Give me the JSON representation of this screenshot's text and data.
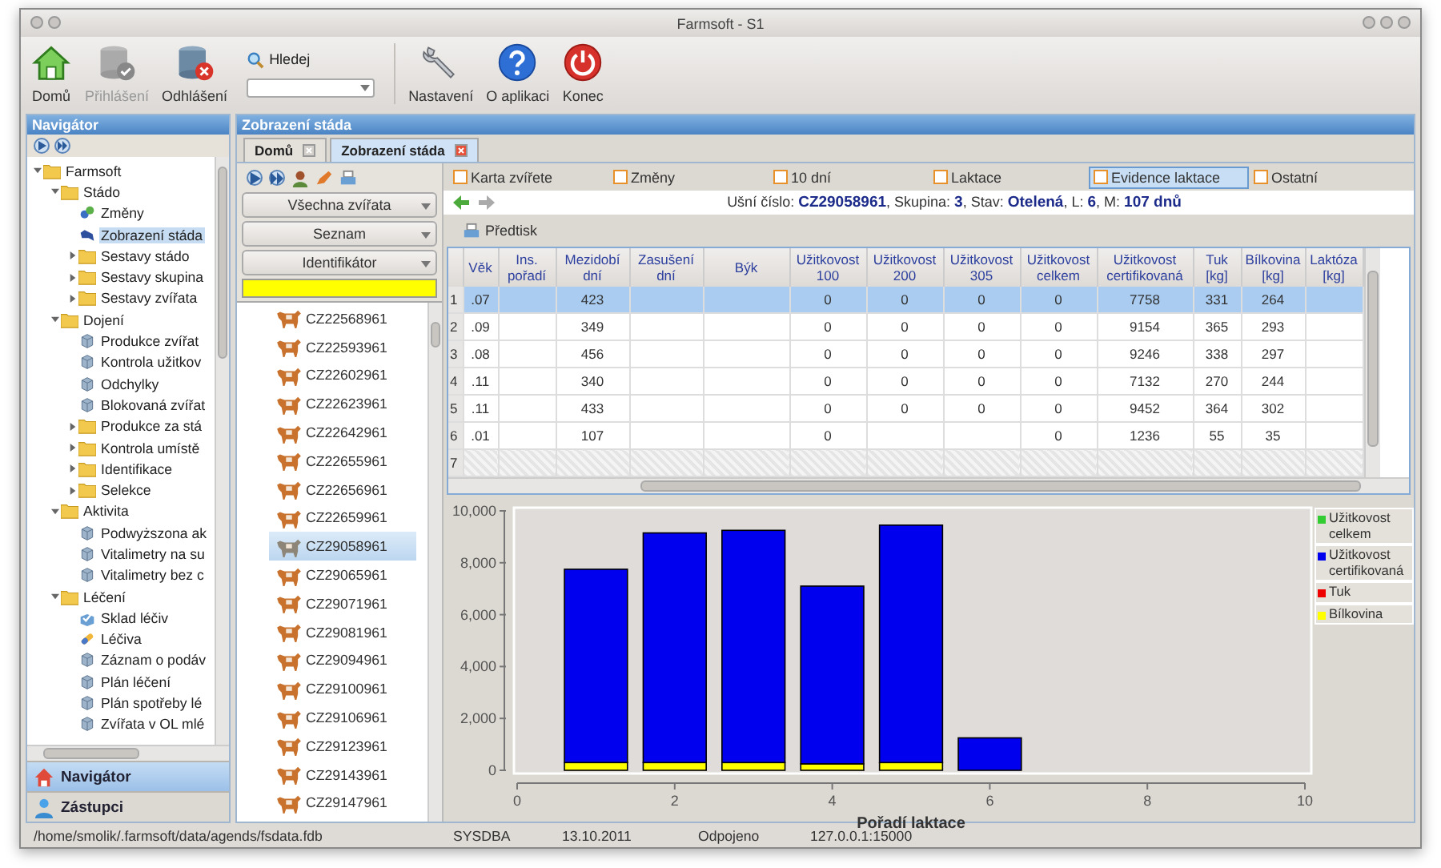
{
  "window": {
    "title": "Farmsoft - S1"
  },
  "toolbar": {
    "buttons": [
      {
        "label": "Domů",
        "kind": "home",
        "disabled": false
      },
      {
        "label": "Přihlášení",
        "kind": "login",
        "disabled": true
      },
      {
        "label": "Odhlášení",
        "kind": "logout",
        "disabled": false
      }
    ],
    "search": {
      "label": "Hledej"
    },
    "buttons_right": [
      {
        "label": "Nastavení",
        "kind": "settings",
        "disabled": false
      },
      {
        "label": "O aplikaci",
        "kind": "help",
        "disabled": false
      },
      {
        "label": "Konec",
        "kind": "power",
        "disabled": false
      }
    ]
  },
  "navigator": {
    "title": "Navigátor",
    "tree": [
      {
        "label": "Farmsoft",
        "kind": "folder",
        "expanded": true,
        "selected": false,
        "children": [
          {
            "label": "Stádo",
            "kind": "folder",
            "expanded": true,
            "selected": false,
            "children": [
              {
                "label": "Změny",
                "kind": "changes",
                "selected": false
              },
              {
                "label": "Zobrazení stáda",
                "kind": "herd",
                "selected": true
              },
              {
                "label": "Sestavy stádo",
                "kind": "folder",
                "expanded": false,
                "selected": false
              },
              {
                "label": "Sestavy skupina",
                "kind": "folder",
                "expanded": false,
                "selected": false
              },
              {
                "label": "Sestavy zvířata",
                "kind": "folder",
                "expanded": false,
                "selected": false
              }
            ]
          },
          {
            "label": "Dojení",
            "kind": "folder",
            "expanded": true,
            "selected": false,
            "children": [
              {
                "label": "Produkce zvířat",
                "kind": "report",
                "selected": false
              },
              {
                "label": "Kontrola užitkov",
                "kind": "report",
                "selected": false
              },
              {
                "label": "Odchylky",
                "kind": "report",
                "selected": false
              },
              {
                "label": "Blokovaná zvířat",
                "kind": "report",
                "selected": false
              },
              {
                "label": "Produkce za stá",
                "kind": "folder",
                "expanded": false,
                "selected": false
              },
              {
                "label": "Kontrola umístě",
                "kind": "folder",
                "expanded": false,
                "selected": false
              },
              {
                "label": "Identifikace",
                "kind": "folder",
                "expanded": false,
                "selected": false
              },
              {
                "label": "Selekce",
                "kind": "folder",
                "expanded": false,
                "selected": false
              }
            ]
          },
          {
            "label": "Aktivita",
            "kind": "folder",
            "expanded": true,
            "selected": false,
            "children": [
              {
                "label": "Podwyższona ak",
                "kind": "report",
                "selected": false
              },
              {
                "label": "Vitalimetry na su",
                "kind": "report",
                "selected": false
              },
              {
                "label": "Vitalimetry bez c",
                "kind": "report",
                "selected": false
              }
            ]
          },
          {
            "label": "Léčení",
            "kind": "folder",
            "expanded": true,
            "selected": false,
            "children": [
              {
                "label": "Sklad léčiv",
                "kind": "medicine",
                "selected": false
              },
              {
                "label": "Léčiva",
                "kind": "pill",
                "selected": false
              },
              {
                "label": "Záznam o podáv",
                "kind": "report",
                "selected": false
              },
              {
                "label": "Plán léčení",
                "kind": "report",
                "selected": false
              },
              {
                "label": "Plán spotřeby lé",
                "kind": "report",
                "selected": false
              },
              {
                "label": "Zvířata v OL mlé",
                "kind": "report",
                "selected": false
              }
            ]
          }
        ]
      }
    ],
    "sections": [
      {
        "label": "Navigátor",
        "kind": "home",
        "selected": true
      },
      {
        "label": "Zástupci",
        "kind": "person",
        "selected": false
      }
    ]
  },
  "main": {
    "title": "Zobrazení stáda",
    "tabs": [
      {
        "label": "Domů",
        "selected": false
      },
      {
        "label": "Zobrazení stáda",
        "selected": true
      }
    ]
  },
  "animal_list": {
    "filters": [
      "Všechna zvířata",
      "Seznam",
      "Identifikátor"
    ],
    "items": [
      {
        "label": "CZ22568961",
        "selected": false
      },
      {
        "label": "CZ22593961",
        "selected": false
      },
      {
        "label": "CZ22602961",
        "selected": false
      },
      {
        "label": "CZ22623961",
        "selected": false
      },
      {
        "label": "CZ22642961",
        "selected": false
      },
      {
        "label": "CZ22655961",
        "selected": false
      },
      {
        "label": "CZ22656961",
        "selected": false
      },
      {
        "label": "CZ22659961",
        "selected": false
      },
      {
        "label": "CZ29058961",
        "selected": true
      },
      {
        "label": "CZ29065961",
        "selected": false
      },
      {
        "label": "CZ29071961",
        "selected": false
      },
      {
        "label": "CZ29081961",
        "selected": false
      },
      {
        "label": "CZ29094961",
        "selected": false
      },
      {
        "label": "CZ29100961",
        "selected": false
      },
      {
        "label": "CZ29106961",
        "selected": false
      },
      {
        "label": "CZ29123961",
        "selected": false
      },
      {
        "label": "CZ29143961",
        "selected": false
      },
      {
        "label": "CZ29147961",
        "selected": false
      }
    ]
  },
  "detail": {
    "tabs": [
      {
        "label": "Karta zvířete",
        "selected": false
      },
      {
        "label": "Změny",
        "selected": false
      },
      {
        "label": "10 dní",
        "selected": false
      },
      {
        "label": "Laktace",
        "selected": false
      },
      {
        "label": "Evidence laktace",
        "selected": true
      },
      {
        "label": "Ostatní",
        "selected": false
      }
    ],
    "info": "Ušní číslo: **CZ29058961**, Skupina: **3**, Stav: **Otelená**, L: **6**, M: **107 dnů**",
    "print_button": "Předtisk",
    "table": {
      "columns": [
        "Věk",
        "Ins. pořadí",
        "Mezidobí dní",
        "Zasušení dní",
        "Býk",
        "Užitkovost 100",
        "Užitkovost 200",
        "Užitkovost 305",
        "Užitkovost celkem",
        "Užitkovost certifikovaná",
        "Tuk [kg]",
        "Bílkovina [kg]",
        "Laktóza [kg]"
      ],
      "rows": [
        {
          "number": "1",
          "selected": true,
          "cells": [
            ".07",
            "",
            "423",
            "",
            "",
            "0",
            "0",
            "0",
            "0",
            "7758",
            "331",
            "264",
            ""
          ]
        },
        {
          "number": "2",
          "selected": false,
          "cells": [
            ".09",
            "",
            "349",
            "",
            "",
            "0",
            "0",
            "0",
            "0",
            "9154",
            "365",
            "293",
            ""
          ]
        },
        {
          "number": "3",
          "selected": false,
          "cells": [
            ".08",
            "",
            "456",
            "",
            "",
            "0",
            "0",
            "0",
            "0",
            "9246",
            "338",
            "297",
            ""
          ]
        },
        {
          "number": "4",
          "selected": false,
          "cells": [
            ".11",
            "",
            "340",
            "",
            "",
            "0",
            "0",
            "0",
            "0",
            "7132",
            "270",
            "244",
            ""
          ]
        },
        {
          "number": "5",
          "selected": false,
          "cells": [
            ".11",
            "",
            "433",
            "",
            "",
            "0",
            "0",
            "0",
            "0",
            "9452",
            "364",
            "302",
            ""
          ]
        },
        {
          "number": "6",
          "selected": false,
          "cells": [
            ".01",
            "",
            "107",
            "",
            "",
            "0",
            "",
            "",
            "0",
            "1236",
            "55",
            "35",
            ""
          ]
        },
        {
          "number": "7",
          "selected": false,
          "cells": [
            "",
            "",
            "",
            "",
            "",
            "",
            "",
            "",
            "",
            "",
            "",
            "",
            ""
          ]
        }
      ]
    },
    "chart_data": {
      "type": "bar",
      "xlabel": "Pořadí laktace",
      "x": [
        1,
        2,
        3,
        4,
        5,
        6
      ],
      "stacked": true,
      "series": [
        {
          "name": "Užitkovost celkem",
          "color": "#33cc33",
          "values": [
            null,
            null,
            null,
            null,
            null,
            null
          ]
        },
        {
          "name": "Užitkovost certifikovaná",
          "color": "#0000ee",
          "values": [
            7450,
            8850,
            8950,
            6850,
            9150,
            1250
          ]
        },
        {
          "name": "Tuk",
          "color": "#ee0000",
          "values": [
            null,
            null,
            null,
            null,
            null,
            null
          ]
        },
        {
          "name": "Bílkovina",
          "color": "#ffff00",
          "values": [
            300,
            300,
            300,
            250,
            300,
            null
          ]
        }
      ],
      "xlim": [
        0,
        10
      ],
      "ylim": [
        0,
        10000
      ],
      "xticks": [
        0,
        2,
        4,
        6,
        8,
        10
      ],
      "yticks": [
        {
          "value": 0,
          "label": "0"
        },
        {
          "value": 2000,
          "label": "2,000"
        },
        {
          "value": 4000,
          "label": "4,000"
        },
        {
          "value": 6000,
          "label": "6,000"
        },
        {
          "value": 8000,
          "label": "8,000"
        },
        {
          "value": 10000,
          "label": "10,000"
        }
      ]
    }
  },
  "status_bar": [
    "/home/smolik/.farmsoft/data/agends/fsdata.fdb",
    "SYSDBA",
    "13.10.2011",
    "Odpojeno",
    "127.0.0.1:15000"
  ]
}
